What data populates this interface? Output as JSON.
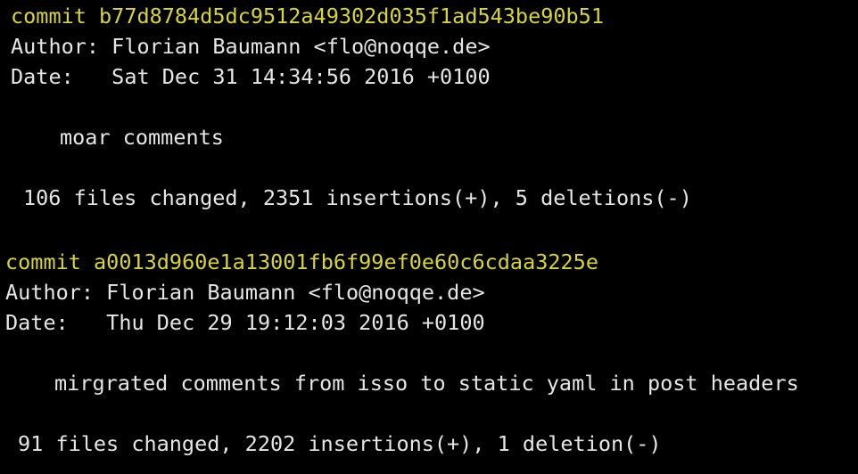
{
  "colors": {
    "background": "#000000",
    "text": "#e6e6e6",
    "commit_hash": "#d8d43a"
  },
  "commits": [
    {
      "commit_line": "commit b77d8784d5dc9512a49302d035f1ad543be90b51",
      "author_line": "Author: Florian Baumann <flo@noqqe.de>",
      "date_line": "Date:   Sat Dec 31 14:34:56 2016 +0100",
      "message": "moar comments",
      "stats": "106 files changed, 2351 insertions(+), 5 deletions(-)"
    },
    {
      "commit_line": "commit a0013d960e1a13001fb6f99ef0e60c6cdaa3225e",
      "author_line": "Author: Florian Baumann <flo@noqqe.de>",
      "date_line": "Date:   Thu Dec 29 19:12:03 2016 +0100",
      "message": "mirgrated comments from isso to static yaml in post headers",
      "stats": "91 files changed, 2202 insertions(+), 1 deletion(-)"
    }
  ]
}
